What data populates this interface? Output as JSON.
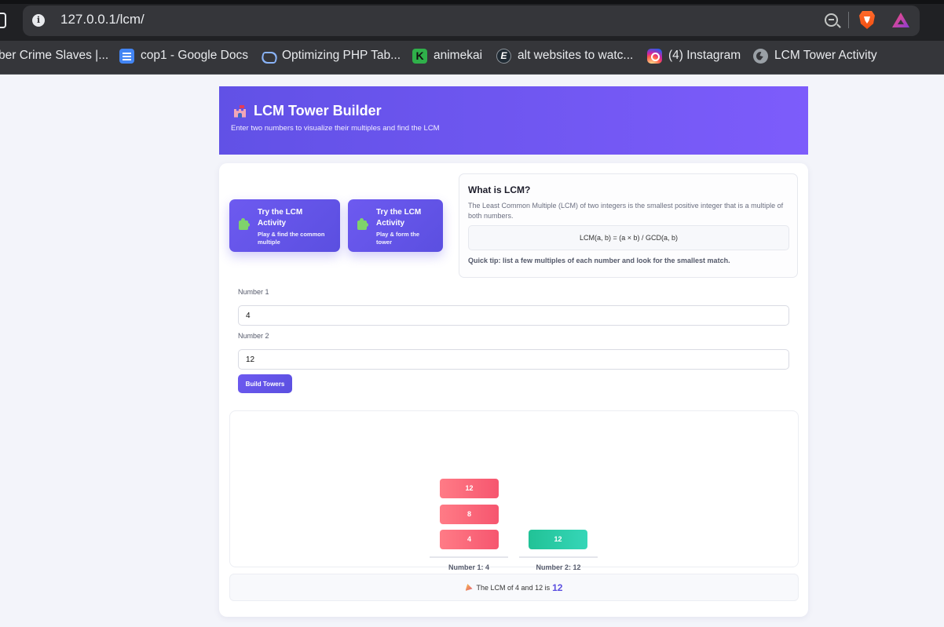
{
  "browser": {
    "url": "127.0.0.1/lcm/",
    "bookmarks": [
      {
        "label": "ber Crime Slaves |...",
        "icon": "bookmark-icon"
      },
      {
        "label": "cop1 - Google Docs",
        "icon": "google-docs-icon"
      },
      {
        "label": "Optimizing PHP Tab...",
        "icon": "php-icon"
      },
      {
        "label": "animekai",
        "icon": "animekai-icon"
      },
      {
        "label": "alt websites to watc...",
        "icon": "e-icon"
      },
      {
        "label": "(4) Instagram",
        "icon": "instagram-icon"
      },
      {
        "label": "LCM Tower Activity",
        "icon": "globe-icon"
      }
    ]
  },
  "header": {
    "title": "LCM Tower Builder",
    "subtitle": "Enter two numbers to visualize their multiples and find the LCM"
  },
  "activities": [
    {
      "title": "Try the LCM Activity",
      "subtitle": "Play & find the common multiple"
    },
    {
      "title": "Try the LCM Activity",
      "subtitle": "Play & form the tower"
    }
  ],
  "info": {
    "title": "What is LCM?",
    "description": "The Least Common Multiple (LCM) of two integers is the smallest positive integer that is a multiple of both numbers.",
    "formula": "LCM(a, b) = (a × b) / GCD(a, b)",
    "tip": "Quick tip: list a few multiples of each number and look for the smallest match."
  },
  "form": {
    "number1_label": "Number 1",
    "number1_value": "4",
    "number2_label": "Number 2",
    "number2_value": "12",
    "build_button": "Build Towers"
  },
  "towers": [
    {
      "label": "Number 1: 4",
      "blocks": [
        "4",
        "8",
        "12"
      ],
      "color": "#f6566f"
    },
    {
      "label": "Number 2: 12",
      "blocks": [
        "12"
      ],
      "color": "#21c296"
    }
  ],
  "result": {
    "text": "The LCM of 4 and 12 is",
    "value": "12"
  },
  "colors": {
    "accent": "#6151e6",
    "tower1": "#f6566f",
    "tower2": "#21c296"
  }
}
